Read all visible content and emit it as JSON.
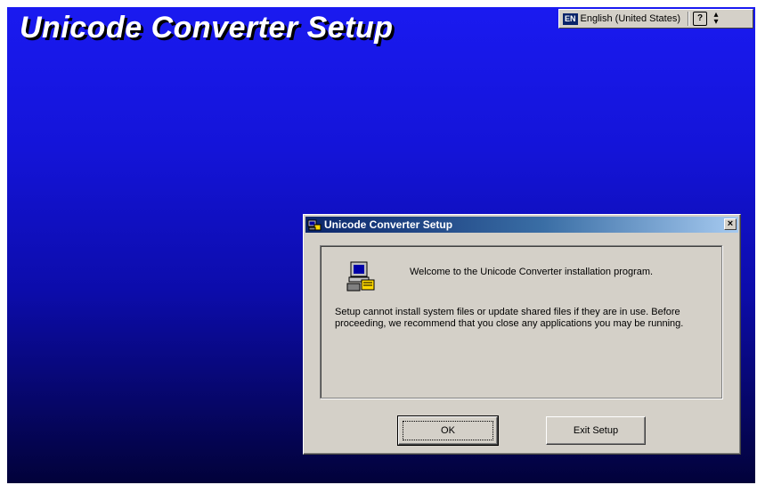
{
  "background": {
    "title": "Unicode Converter Setup"
  },
  "language_bar": {
    "code": "EN",
    "language": "English (United States)",
    "help_icon": "help-icon",
    "options_icon": "options-icon"
  },
  "dialog": {
    "title": "Unicode Converter Setup",
    "close_label": "×",
    "welcome": "Welcome to the Unicode Converter installation program.",
    "info": "Setup cannot install system files or update shared files if they are in use. Before proceeding, we recommend that you close any applications you may be running.",
    "ok_label": "OK",
    "exit_label": "Exit Setup"
  },
  "colors": {
    "desktop_top": "#1a1af0",
    "desktop_bottom": "#02023a",
    "titlebar_active": "#0a246a",
    "dialog_face": "#d4d0c8"
  }
}
